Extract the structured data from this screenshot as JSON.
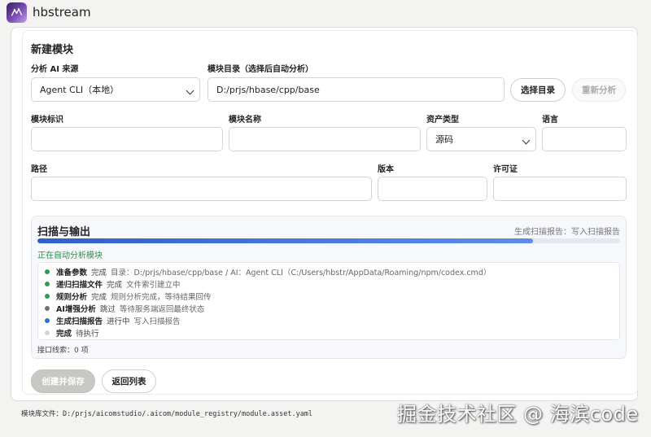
{
  "app": {
    "title": "hbstream"
  },
  "form": {
    "section_title": "新建模块",
    "ai_source": {
      "label": "分析 AI 来源",
      "value": "Agent CLI（本地）"
    },
    "module_dir": {
      "label": "模块目录（选择后自动分析）",
      "value": "D:/prjs/hbase/cpp/base"
    },
    "choose_dir_label": "选择目录",
    "reanalyze_label": "重新分析",
    "module_id": {
      "label": "模块标识",
      "value": ""
    },
    "module_name": {
      "label": "模块名称",
      "value": ""
    },
    "asset_type": {
      "label": "资产类型",
      "value": "源码"
    },
    "language": {
      "label": "语言",
      "value": ""
    },
    "path": {
      "label": "路径",
      "value": ""
    },
    "version": {
      "label": "版本",
      "value": ""
    },
    "license": {
      "label": "许可证",
      "value": ""
    }
  },
  "scan": {
    "title": "扫描与输出",
    "right_status": "生成扫描报告：写入扫描报告",
    "progress": 0.85,
    "auto_status": "正在自动分析模块",
    "steps": [
      {
        "name": "准备参数",
        "state": "完成",
        "detail": "目录：D:/prjs/hbase/cpp/base / AI：Agent CLI（C:/Users/hbstr/AppData/Roaming/npm/codex.cmd）",
        "color": "#2e9d4f"
      },
      {
        "name": "递归扫描文件",
        "state": "完成",
        "detail": "文件索引建立中",
        "color": "#2e9d4f"
      },
      {
        "name": "规则分析",
        "state": "完成",
        "detail": "规则分析完成，等待结果回传",
        "color": "#2e9d4f"
      },
      {
        "name": "AI增强分析",
        "state": "跳过",
        "detail": "等待服务端返回最终状态",
        "color": "#6b7280"
      },
      {
        "name": "生成扫描报告",
        "state": "进行中",
        "detail": "写入扫描报告",
        "color": "#2f6fd8"
      },
      {
        "name": "完成",
        "state": "待执行",
        "detail": "",
        "color": "#d1d5db"
      }
    ],
    "iface_hint": "接口线索：0 项"
  },
  "actions": {
    "create_save_label": "创建并保存",
    "back_label": "返回列表"
  },
  "footer": {
    "text": "模块库文件：D:/prjs/aicomstudio/.aicom/module_registry/module.asset.yaml"
  },
  "watermark": "掘金技术社区 @ 海滨code"
}
